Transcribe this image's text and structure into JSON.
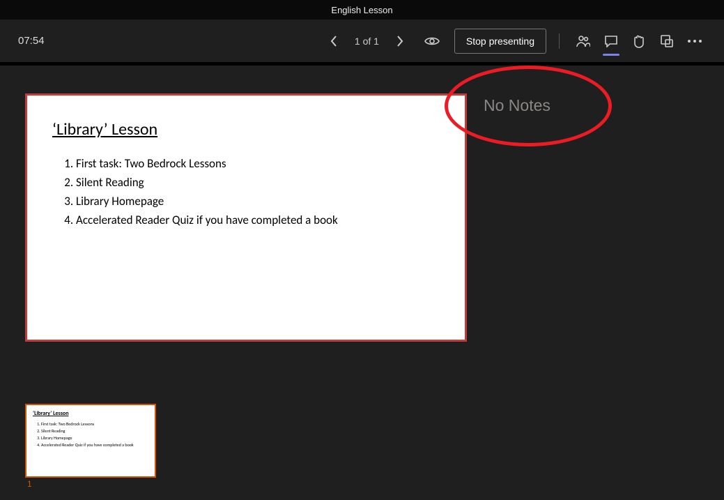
{
  "title": "English Lesson",
  "toolbar": {
    "time": "07:54",
    "page_counter": "1 of 1",
    "stop_label": "Stop presenting"
  },
  "slide": {
    "heading": "‘Library’ Lesson",
    "items": [
      "First task: Two Bedrock Lessons",
      "Silent Reading",
      "Library Homepage",
      "Accelerated Reader Quiz if you have completed a book"
    ]
  },
  "notes": {
    "empty_label": "No Notes"
  },
  "thumbnail": {
    "number": "1"
  }
}
